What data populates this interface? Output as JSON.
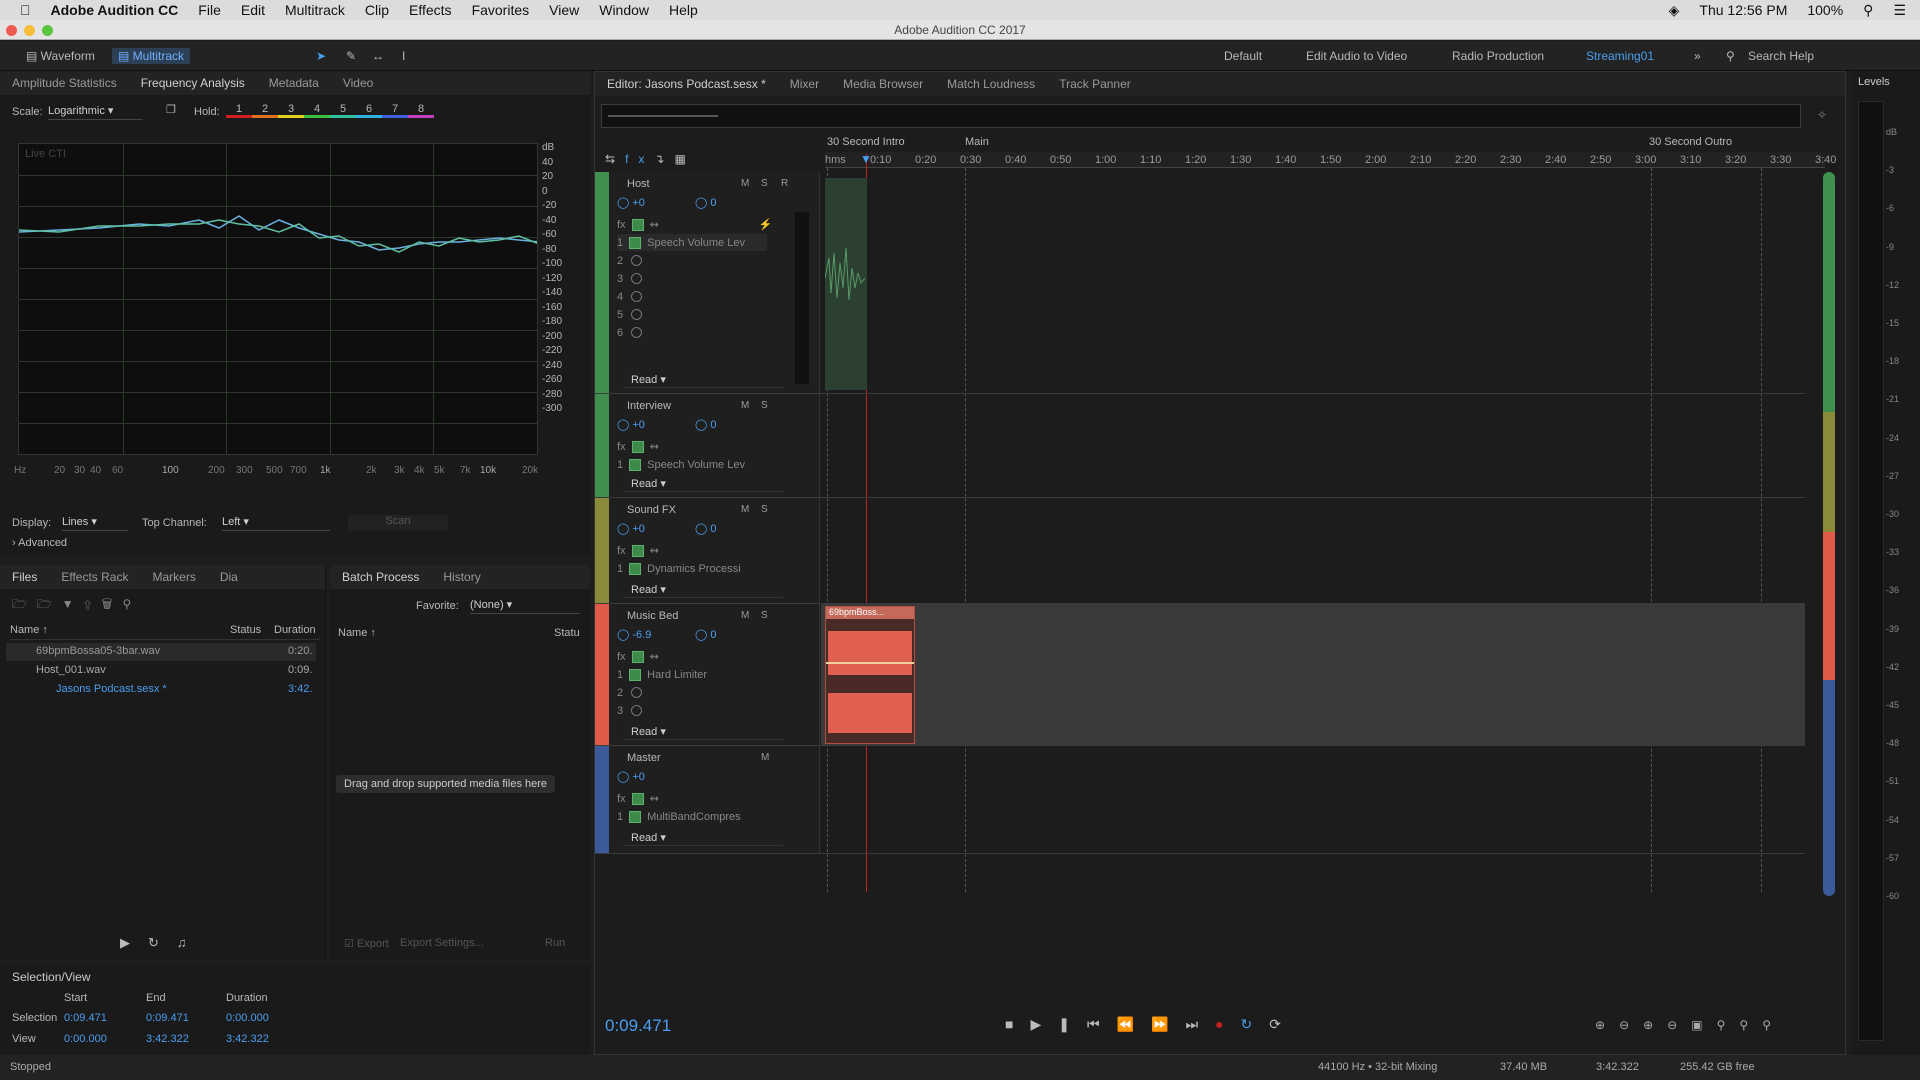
{
  "menubar": {
    "app": "Adobe Audition CC",
    "items": [
      "File",
      "Edit",
      "Multitrack",
      "Clip",
      "Effects",
      "Favorites",
      "View",
      "Window",
      "Help"
    ],
    "clock": "Thu 12:56 PM",
    "battery": "100%"
  },
  "window": {
    "title": "Adobe Audition CC 2017"
  },
  "toolbar": {
    "waveform": "Waveform",
    "multitrack": "Multitrack",
    "workspaces": [
      "Default",
      "Edit Audio to Video",
      "Radio Production",
      "Streaming01"
    ],
    "search": "Search Help"
  },
  "left_top": {
    "tabs": [
      "Amplitude Statistics",
      "Frequency Analysis",
      "Metadata",
      "Video"
    ],
    "scale_label": "Scale:",
    "scale_value": "Logarithmic",
    "hold_label": "Hold:",
    "holds": [
      "1",
      "2",
      "3",
      "4",
      "5",
      "6",
      "7",
      "8"
    ],
    "live": "Live CTI",
    "db_labels": [
      "dB",
      "40",
      "20",
      "0",
      "-20",
      "-40",
      "-60",
      "-80",
      "-100",
      "-120",
      "-140",
      "-160",
      "-180",
      "-200",
      "-220",
      "-240",
      "-260",
      "-280",
      "-300"
    ],
    "hz_labels": [
      "Hz",
      "20",
      "30",
      "40",
      "60",
      "100",
      "200",
      "300",
      "500",
      "700",
      "1k",
      "2k",
      "3k",
      "4k",
      "5k",
      "7k",
      "10k",
      "20k"
    ],
    "display_label": "Display:",
    "display_value": "Lines",
    "top_channel_label": "Top Channel:",
    "top_channel_value": "Left",
    "scan": "Scan",
    "advanced": "Advanced"
  },
  "files": {
    "tabs": [
      "Files",
      "Effects Rack",
      "Markers",
      "Dia"
    ],
    "cols": [
      "Name ↑",
      "Status",
      "Duration"
    ],
    "rows": [
      {
        "name": "69bpmBossa05-3bar.wav",
        "dur": "0:20."
      },
      {
        "name": "Host_001.wav",
        "dur": "0:09."
      },
      {
        "name": "Jasons Podcast.sesx *",
        "dur": "3:42."
      }
    ]
  },
  "batch": {
    "tabs": [
      "Batch Process",
      "History"
    ],
    "favorite_label": "Favorite:",
    "favorite_value": "(None)",
    "cols": [
      "Name ↑",
      "Statu"
    ],
    "drop": "Drag and drop supported media files here",
    "export": "Export",
    "export_settings": "Export Settings...",
    "run": "Run"
  },
  "selection": {
    "title": "Selection/View",
    "cols": [
      "Start",
      "End",
      "Duration"
    ],
    "rows": [
      {
        "label": "Selection",
        "start": "0:09.471",
        "end": "0:09.471",
        "dur": "0:00.000"
      },
      {
        "label": "View",
        "start": "0:00.000",
        "end": "3:42.322",
        "dur": "3:42.322"
      }
    ]
  },
  "editor": {
    "tabs": [
      "Editor: Jasons Podcast.sesx *",
      "Mixer",
      "Media Browser",
      "Match Loudness",
      "Track Panner"
    ],
    "markers": [
      "30 Second Intro",
      "Main",
      "30 Second Outro"
    ],
    "ruler": [
      "hms",
      "0:10",
      "0:20",
      "0:30",
      "0:40",
      "0:50",
      "1:00",
      "1:10",
      "1:20",
      "1:30",
      "1:40",
      "1:50",
      "2:00",
      "2:10",
      "2:20",
      "2:30",
      "2:40",
      "2:50",
      "3:00",
      "3:10",
      "3:20",
      "3:30",
      "3:40"
    ],
    "time": "0:09.471"
  },
  "tracks": [
    {
      "name": "Host",
      "vol": "+0",
      "pan": "0",
      "fx": [
        "Speech Volume Lev",
        "",
        "",
        "",
        "",
        ""
      ],
      "read": "Read",
      "color": "#3f8f4e"
    },
    {
      "name": "Interview",
      "vol": "+0",
      "pan": "0",
      "fx": [
        "Speech Volume Lev"
      ],
      "read": "Read",
      "color": "#3f8f4e"
    },
    {
      "name": "Sound FX",
      "vol": "+0",
      "pan": "0",
      "fx": [
        "Dynamics Processi"
      ],
      "read": "Read",
      "color": "#8a8a3a"
    },
    {
      "name": "Music Bed",
      "vol": "-6.9",
      "pan": "0",
      "fx": [
        "Hard Limiter",
        "",
        ""
      ],
      "read": "Read",
      "color": "#e05a4a"
    },
    {
      "name": "Master",
      "vol": "+0",
      "pan": "",
      "fx": [
        "MultiBandCompres"
      ],
      "read": "Read",
      "color": "#3a5a9a"
    }
  ],
  "clip": {
    "name": "69bpmBoss..."
  },
  "levels": {
    "title": "Levels",
    "labels": [
      "dB",
      "-3",
      "-6",
      "-9",
      "-12",
      "-15",
      "-18",
      "-21",
      "-24",
      "-27",
      "-30",
      "-33",
      "-36",
      "-39",
      "-42",
      "-45",
      "-48",
      "-51",
      "-54",
      "-57",
      "-60"
    ]
  },
  "status": {
    "state": "Stopped",
    "format": "44100 Hz • 32-bit Mixing",
    "size": "37.40 MB",
    "dur": "3:42.322",
    "free": "255.42 GB free"
  }
}
